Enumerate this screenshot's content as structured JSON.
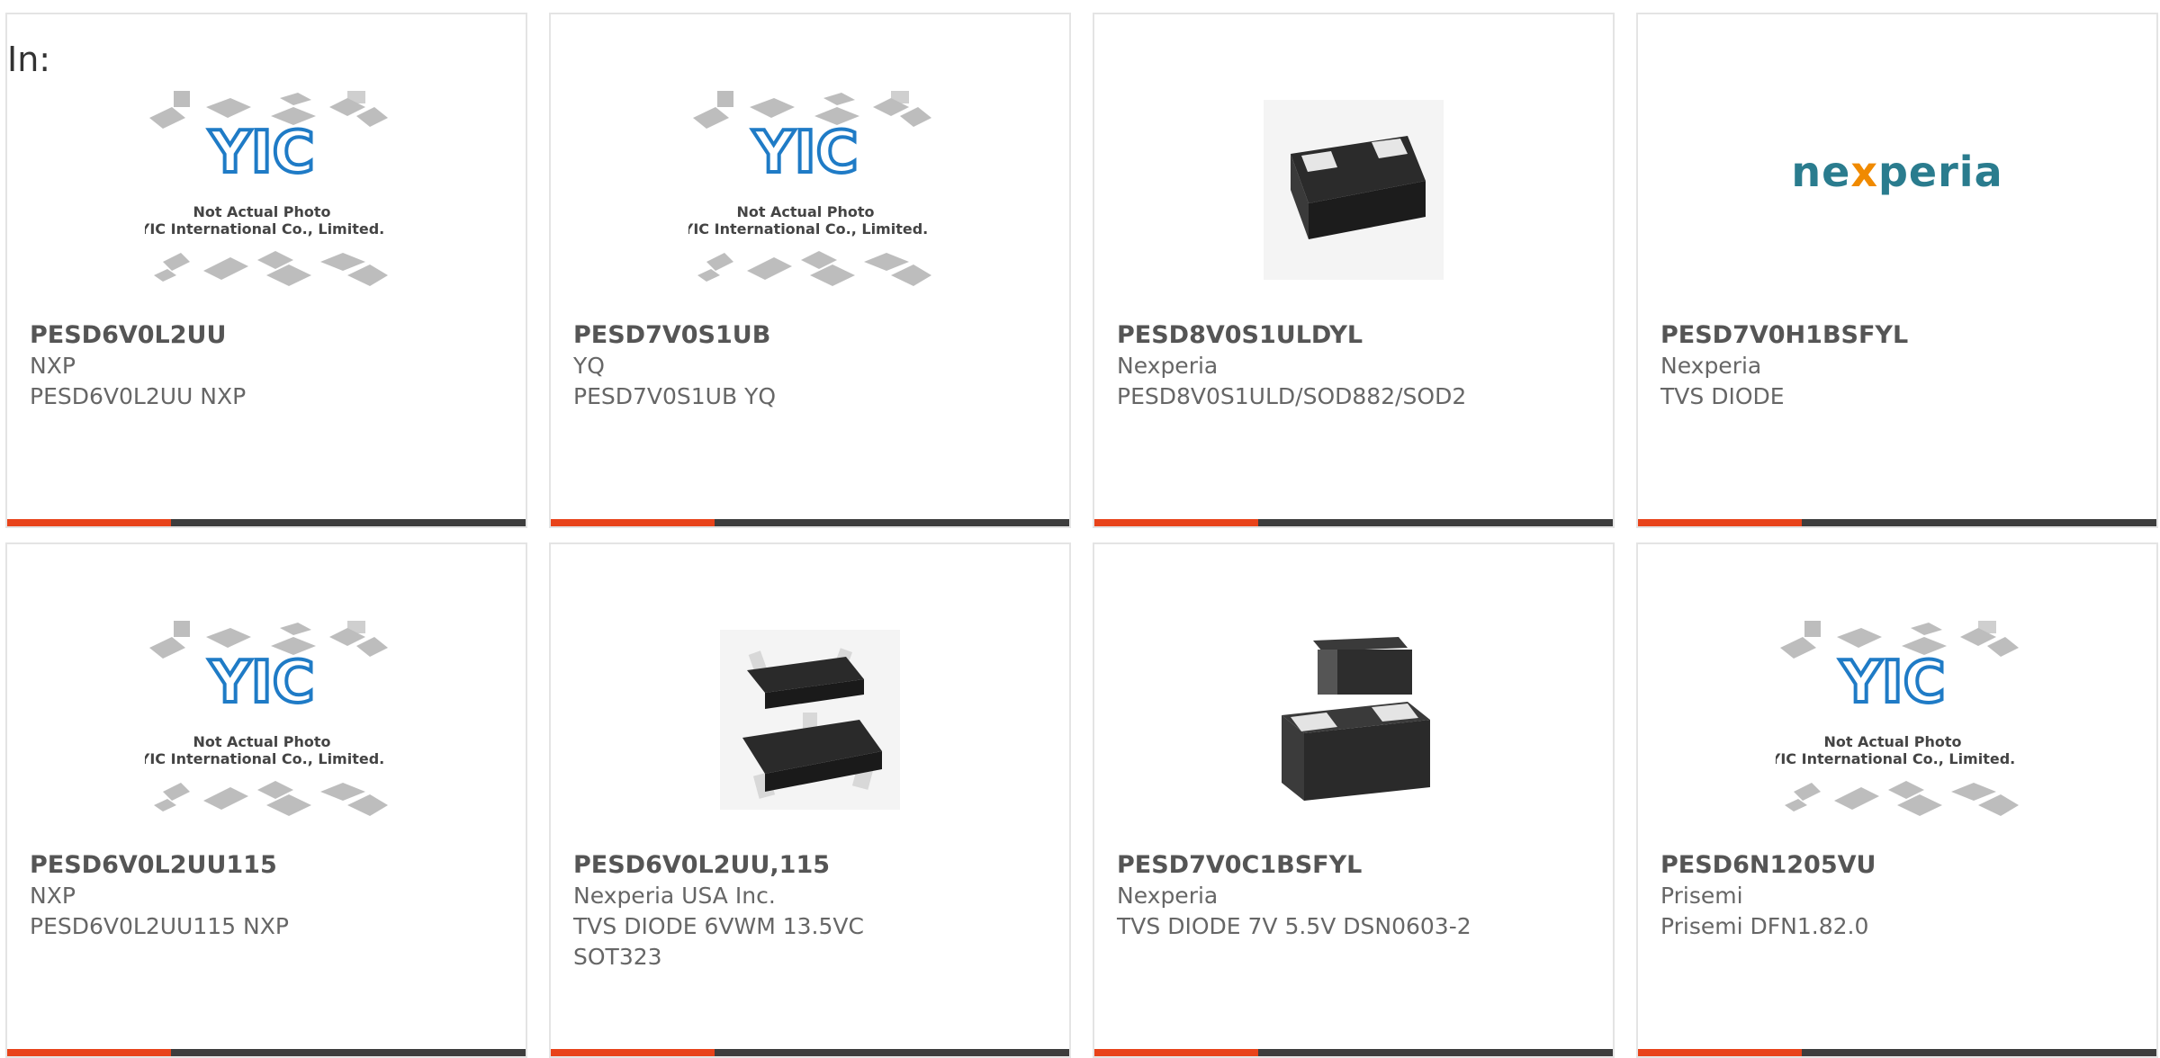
{
  "page": {
    "in_label": "In:"
  },
  "placeholder": {
    "line1": "Not Actual Photo",
    "line2": "YIC International Co., Limited.",
    "logo": "YIC"
  },
  "nexperia_logo": {
    "part1": "ne",
    "part2": "x",
    "part3": "peria"
  },
  "colors": {
    "accent": "#e8431a",
    "bar": "#3d3d3d",
    "yic_blue": "#1f7bc6"
  },
  "products": [
    {
      "part": "PESD6V0L2UU",
      "manufacturer": "NXP",
      "desc": [
        "PESD6V0L2UU NXP"
      ],
      "image": "placeholder"
    },
    {
      "part": "PESD7V0S1UB",
      "manufacturer": "YQ",
      "desc": [
        "PESD7V0S1UB YQ"
      ],
      "image": "placeholder"
    },
    {
      "part": "PESD8V0S1ULDYL",
      "manufacturer": "Nexperia",
      "desc": [
        "PESD8V0S1ULD/SOD882/SOD2"
      ],
      "image": "chip-2pad"
    },
    {
      "part": "PESD7V0H1BSFYL",
      "manufacturer": "Nexperia",
      "desc": [
        "TVS DIODE"
      ],
      "image": "nexperia-logo"
    },
    {
      "part": "PESD6V0L2UU115",
      "manufacturer": "NXP",
      "desc": [
        "PESD6V0L2UU115 NXP"
      ],
      "image": "placeholder"
    },
    {
      "part": "PESD6V0L2UU,115",
      "manufacturer": "Nexperia USA Inc.",
      "desc": [
        "TVS DIODE 6VWM 13.5VC",
        "SOT323"
      ],
      "image": "sot323"
    },
    {
      "part": "PESD7V0C1BSFYL",
      "manufacturer": "Nexperia",
      "desc": [
        "TVS DIODE 7V 5.5V DSN0603-2"
      ],
      "image": "chip-stack"
    },
    {
      "part": "PESD6N1205VU",
      "manufacturer": "Prisemi",
      "desc": [
        "Prisemi DFN1.82.0"
      ],
      "image": "placeholder"
    }
  ]
}
